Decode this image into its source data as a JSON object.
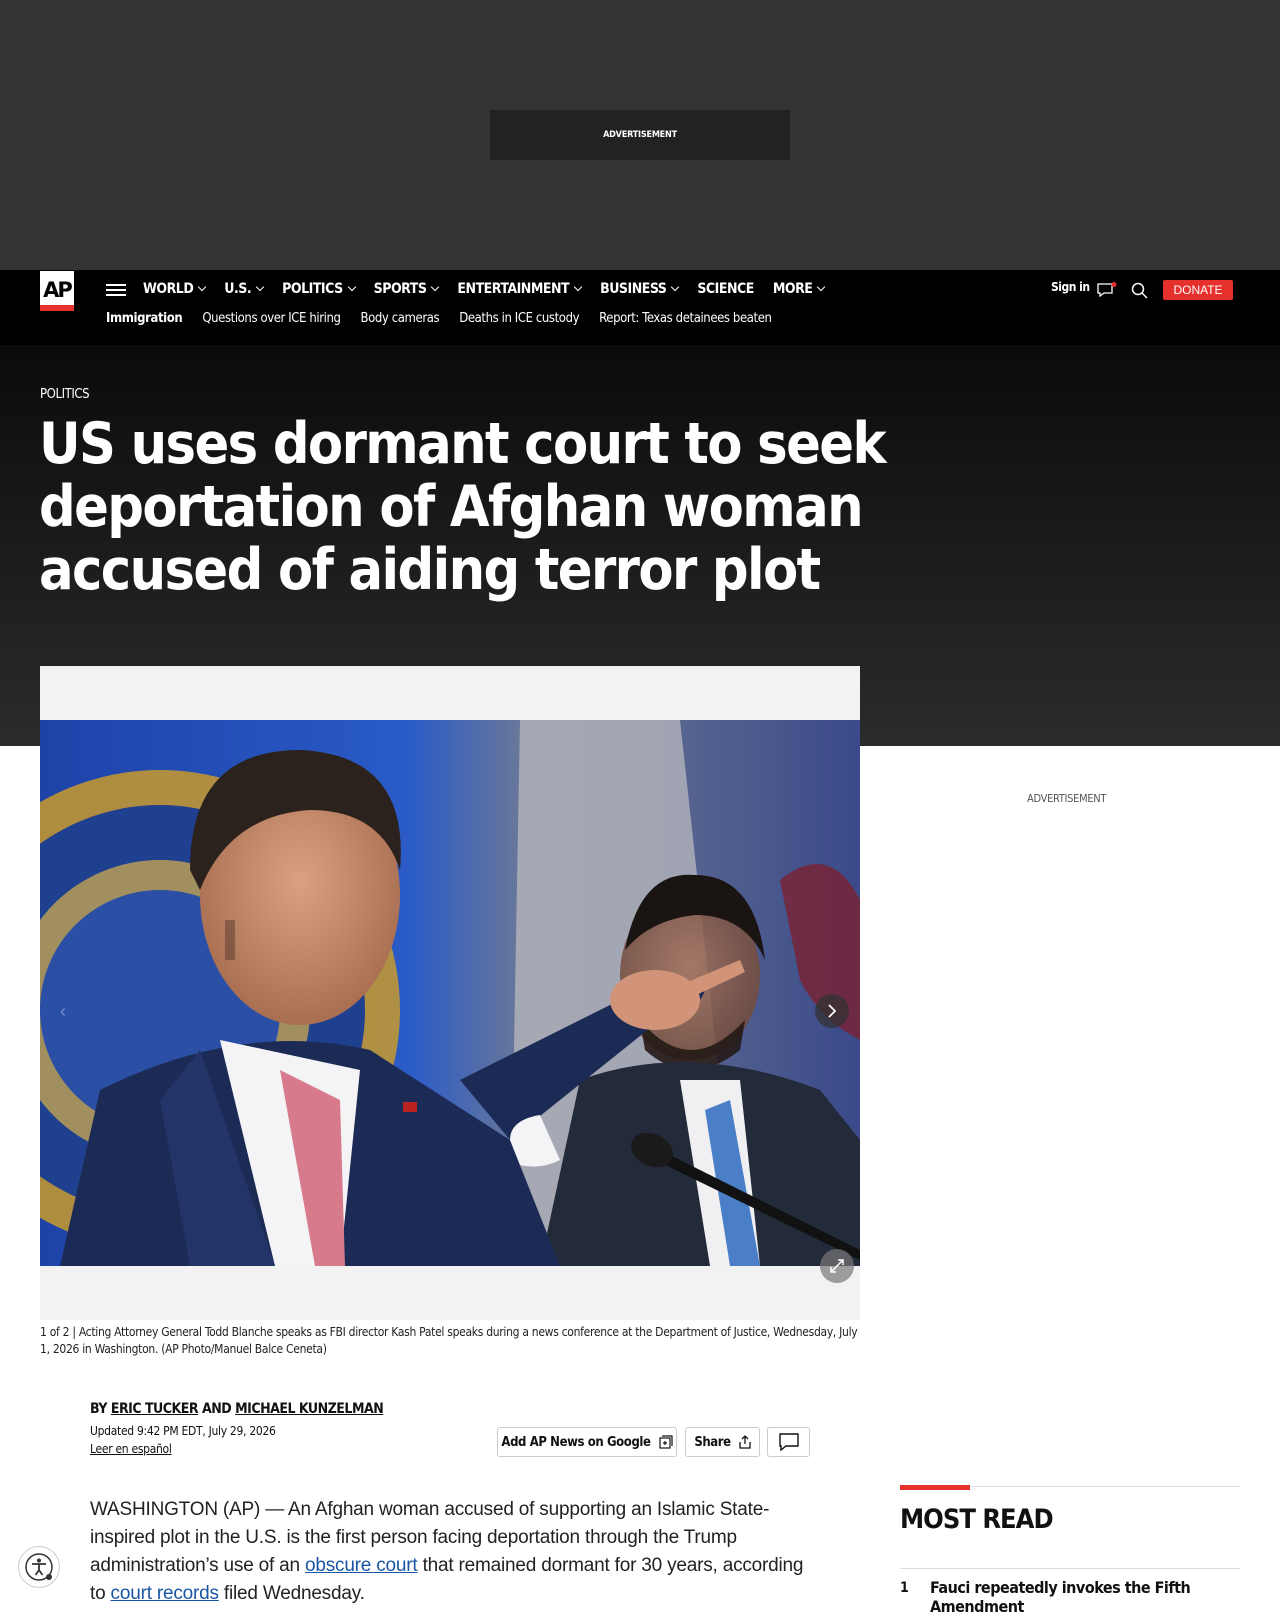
{
  "top_ad": {
    "label": "ADVERTISEMENT"
  },
  "nav": {
    "logo": "AP",
    "items": [
      {
        "label": "WORLD",
        "dropdown": true
      },
      {
        "label": "U.S.",
        "dropdown": true
      },
      {
        "label": "POLITICS",
        "dropdown": true
      },
      {
        "label": "SPORTS",
        "dropdown": true
      },
      {
        "label": "ENTERTAINMENT",
        "dropdown": true
      },
      {
        "label": "BUSINESS",
        "dropdown": true
      },
      {
        "label": "SCIENCE",
        "dropdown": false
      },
      {
        "label": "MORE",
        "dropdown": true
      }
    ],
    "sub_items": [
      "Immigration",
      "Questions over ICE hiring",
      "Body cameras",
      "Deaths in ICE custody",
      "Report: Texas detainees beaten"
    ],
    "signin": "Sign in",
    "donate": "DONATE"
  },
  "article": {
    "section": "POLITICS",
    "headline": "US uses dormant court to seek deportation of Afghan woman accused of aiding terror plot",
    "gallery": {
      "counter": "1 of 2",
      "caption": "Acting Attorney General Todd Blanche speaks as FBI director Kash Patel speaks during a news conference at the Department of Justice, Wednesday, July 1, 2026 in Washington. (AP Photo/Manuel Balce Ceneta)"
    },
    "byline": {
      "prefix": "BY",
      "author1": "ERIC TUCKER",
      "conj": "AND",
      "author2": "MICHAEL KUNZELMAN"
    },
    "updated": "Updated 9:42 PM EDT, July 29, 2026",
    "espanol": "Leer en español",
    "actions": {
      "google": "Add AP News on Google",
      "share": "Share"
    },
    "body": {
      "p1_a": "WASHINGTON (AP) — An Afghan woman accused of supporting an Islamic State-inspired plot in the U.S. is the first person facing deportation through the Trump administration’s use of an ",
      "link1": "obscure court",
      "p1_b": " that remained dormant for 30 years, according to ",
      "link2": "court records",
      "p1_c": " filed Wednesday."
    }
  },
  "rail": {
    "ad_label": "ADVERTISEMENT",
    "most_read_title": "MOST READ",
    "items": [
      {
        "num": "1",
        "title": "Fauci repeatedly invokes the Fifth Amendment"
      }
    ]
  },
  "colors": {
    "accent": "#e5302b",
    "link": "#1a56a5",
    "nav_bg": "#000000",
    "ad_bg": "#333333"
  }
}
